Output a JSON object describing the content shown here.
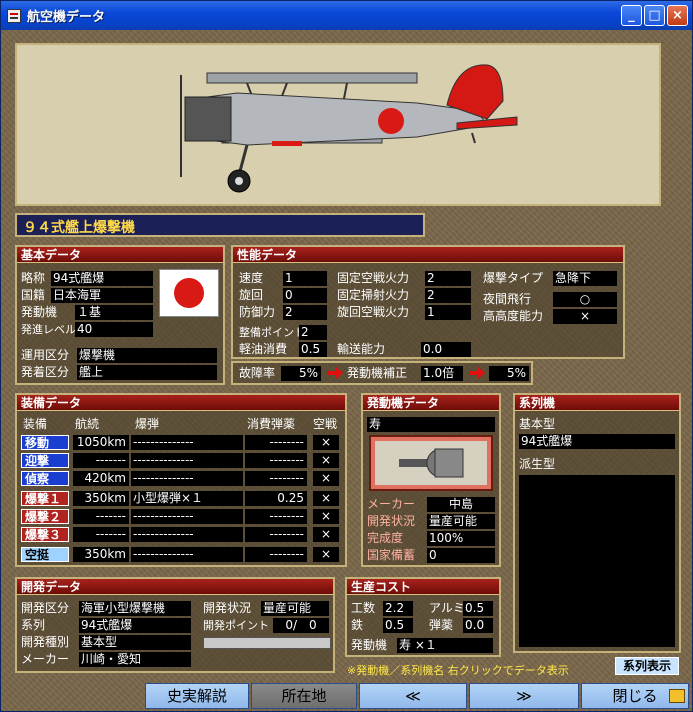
{
  "window": {
    "title": "航空機データ"
  },
  "aircraft_name": "９４式艦上爆撃機",
  "basic": {
    "header": "基本データ",
    "rows": [
      {
        "label": "略称",
        "value": "94式艦爆"
      },
      {
        "label": "国籍",
        "value": "日本海軍"
      },
      {
        "label": "発動機",
        "value": "１基"
      },
      {
        "label": "発進レベル",
        "value": "40"
      }
    ],
    "rows2": [
      {
        "label": "運用区分",
        "value": "爆撃機"
      },
      {
        "label": "発着区分",
        "value": "艦上"
      }
    ]
  },
  "performance": {
    "header": "性能データ",
    "left": [
      {
        "label": "速度",
        "value": "1"
      },
      {
        "label": "旋回",
        "value": "0"
      },
      {
        "label": "防御力",
        "value": "2"
      },
      {
        "label": "整備ポイント",
        "value": "2"
      },
      {
        "label": "軽油消費",
        "value": "0.5"
      }
    ],
    "mid": [
      {
        "label": "固定空戦火力",
        "value": "2"
      },
      {
        "label": "固定掃射火力",
        "value": "2"
      },
      {
        "label": "旋回空戦火力",
        "value": "1"
      },
      {
        "label": "輸送能力",
        "value": "0.0"
      }
    ],
    "right": [
      {
        "label": "爆撃タイプ",
        "value": "急降下"
      },
      {
        "label": "夜間飛行",
        "value": "○"
      },
      {
        "label": "高高度能力",
        "value": "×"
      }
    ],
    "failure_label": "故障率",
    "failure_value": "5%",
    "engine_fix_label": "発動機補正",
    "engine_fix_value": "1.0倍",
    "result_value": "5%"
  },
  "equipment": {
    "header": "装備データ",
    "columns": [
      "装備",
      "航続",
      "爆弾",
      "消費弾薬",
      "空戦"
    ],
    "rows": [
      {
        "name": "移動",
        "range": "1050km",
        "bomb": "--------------",
        "ammo": "--------",
        "air": "×"
      },
      {
        "name": "迎撃",
        "range": "-------",
        "bomb": "--------------",
        "ammo": "--------",
        "air": "×"
      },
      {
        "name": "偵察",
        "range": "420km",
        "bomb": "--------------",
        "ammo": "--------",
        "air": "×"
      },
      {
        "name": "爆撃１",
        "range": "350km",
        "bomb": "小型爆弾×１",
        "ammo": "0.25",
        "air": "×"
      },
      {
        "name": "爆撃２",
        "range": "-------",
        "bomb": "--------------",
        "ammo": "--------",
        "air": "×"
      },
      {
        "name": "爆撃３",
        "range": "-------",
        "bomb": "--------------",
        "ammo": "--------",
        "air": "×"
      },
      {
        "name": "空挺",
        "range": "350km",
        "bomb": "--------------",
        "ammo": "--------",
        "air": "×"
      }
    ]
  },
  "engine": {
    "header": "発動機データ",
    "name": "寿",
    "rows": [
      {
        "label": "メーカー",
        "value": "中島"
      },
      {
        "label": "開発状況",
        "value": "量産可能"
      },
      {
        "label": "完成度",
        "value": "100%"
      },
      {
        "label": "国家備蓄",
        "value": "0"
      }
    ]
  },
  "lineage": {
    "header": "系列機",
    "base_label": "基本型",
    "base_value": "94式艦爆",
    "derived_label": "派生型"
  },
  "development": {
    "header": "開発データ",
    "rows": [
      {
        "label": "開発区分",
        "value": "海軍小型爆撃機"
      },
      {
        "label": "系列",
        "value": "94式艦爆"
      },
      {
        "label": "開発種別",
        "value": "基本型"
      },
      {
        "label": "メーカー",
        "value": "川崎・愛知"
      }
    ],
    "status_label": "開発状況",
    "status_value": "量産可能",
    "points_label": "開発ポイント",
    "points_value": "0/　0"
  },
  "cost": {
    "header": "生産コスト",
    "rows": [
      {
        "label": "工数",
        "value": "2.2"
      },
      {
        "label": "鉄",
        "value": "0.5"
      }
    ],
    "rows2": [
      {
        "label": "アルミ",
        "value": "0.5"
      },
      {
        "label": "弾薬",
        "value": "0.0"
      }
    ],
    "engine_label": "発動機",
    "engine_value": "寿 ×１"
  },
  "note": "※発動機／系列機名 右クリックでデータ表示",
  "lineage_button": "系列表示",
  "bottom": {
    "history": "史実解説",
    "location": "所在地",
    "prev": "≪",
    "next": "≫",
    "close": "閉じる"
  },
  "colors": {
    "header_red": "#a8221c",
    "frame": "#c4b27a",
    "title_blue": "#0a48d8"
  }
}
